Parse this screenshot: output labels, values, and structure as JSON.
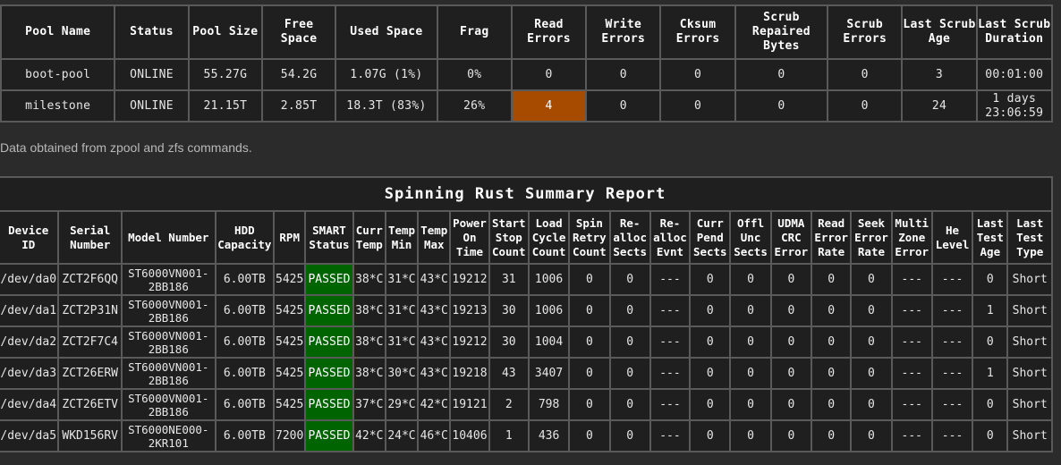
{
  "colors": {
    "background": "#2b2b2b",
    "table_background": "#1f1f1f",
    "border": "#5a5a5a",
    "warning_cell": "#a64b00",
    "passed_cell": "#006400"
  },
  "pool_table": {
    "headers": [
      "Pool Name",
      "Status",
      "Pool Size",
      "Free Space",
      "Used Space",
      "Frag",
      "Read Errors",
      "Write Errors",
      "Cksum Errors",
      "Scrub Repaired Bytes",
      "Scrub Errors",
      "Last Scrub Age",
      "Last Scrub Duration"
    ],
    "rows": [
      [
        "boot-pool",
        "ONLINE",
        "55.27G",
        "54.2G",
        "1.07G (1%)",
        "0%",
        "0",
        "0",
        "0",
        "0",
        "0",
        "3",
        "00:01:00"
      ],
      [
        "milestone",
        "ONLINE",
        "21.15T",
        "2.85T",
        "18.3T (83%)",
        "26%",
        "4",
        "0",
        "0",
        "0",
        "0",
        "24",
        "1 days 23:06:59"
      ]
    ]
  },
  "note": "Data obtained from zpool and zfs commands.",
  "rust_table": {
    "title": "Spinning Rust Summary Report",
    "headers": [
      "Device ID",
      "Serial Number",
      "Model Number",
      "HDD Capacity",
      "RPM",
      "SMART Status",
      "Curr Temp",
      "Temp Min",
      "Temp Max",
      "Power On Time",
      "Start Stop Count",
      "Load Cycle Count",
      "Spin Retry Count",
      "Re-alloc Sects",
      "Re-alloc Evnt",
      "Curr Pend Sects",
      "Offl Unc Sects",
      "UDMA CRC Error",
      "Read Error Rate",
      "Seek Error Rate",
      "Multi Zone Error",
      "He Level",
      "Last Test Age",
      "Last Test Type"
    ],
    "rows": [
      [
        "/dev/da0",
        "ZCT2F6QQ",
        "ST6000VN001-2BB186",
        "6.00TB",
        "5425",
        "PASSED",
        "38*C",
        "31*C",
        "43*C",
        "19212",
        "31",
        "1006",
        "0",
        "0",
        "---",
        "0",
        "0",
        "0",
        "0",
        "0",
        "---",
        "---",
        "0",
        "Short"
      ],
      [
        "/dev/da1",
        "ZCT2P31N",
        "ST6000VN001-2BB186",
        "6.00TB",
        "5425",
        "PASSED",
        "38*C",
        "31*C",
        "43*C",
        "19213",
        "30",
        "1006",
        "0",
        "0",
        "---",
        "0",
        "0",
        "0",
        "0",
        "0",
        "---",
        "---",
        "1",
        "Short"
      ],
      [
        "/dev/da2",
        "ZCT2F7C4",
        "ST6000VN001-2BB186",
        "6.00TB",
        "5425",
        "PASSED",
        "38*C",
        "31*C",
        "43*C",
        "19212",
        "30",
        "1004",
        "0",
        "0",
        "---",
        "0",
        "0",
        "0",
        "0",
        "0",
        "---",
        "---",
        "0",
        "Short"
      ],
      [
        "/dev/da3",
        "ZCT26ERW",
        "ST6000VN001-2BB186",
        "6.00TB",
        "5425",
        "PASSED",
        "38*C",
        "30*C",
        "43*C",
        "19218",
        "43",
        "3407",
        "0",
        "0",
        "---",
        "0",
        "0",
        "0",
        "0",
        "0",
        "---",
        "---",
        "1",
        "Short"
      ],
      [
        "/dev/da4",
        "ZCT26ETV",
        "ST6000VN001-2BB186",
        "6.00TB",
        "5425",
        "PASSED",
        "37*C",
        "29*C",
        "42*C",
        "19121",
        "2",
        "798",
        "0",
        "0",
        "---",
        "0",
        "0",
        "0",
        "0",
        "0",
        "---",
        "---",
        "0",
        "Short"
      ],
      [
        "/dev/da5",
        "WKD156RV",
        "ST6000NE000-2KR101",
        "6.00TB",
        "7200",
        "PASSED",
        "42*C",
        "24*C",
        "46*C",
        "10406",
        "1",
        "436",
        "0",
        "0",
        "---",
        "0",
        "0",
        "0",
        "0",
        "0",
        "---",
        "---",
        "0",
        "Short"
      ]
    ]
  }
}
